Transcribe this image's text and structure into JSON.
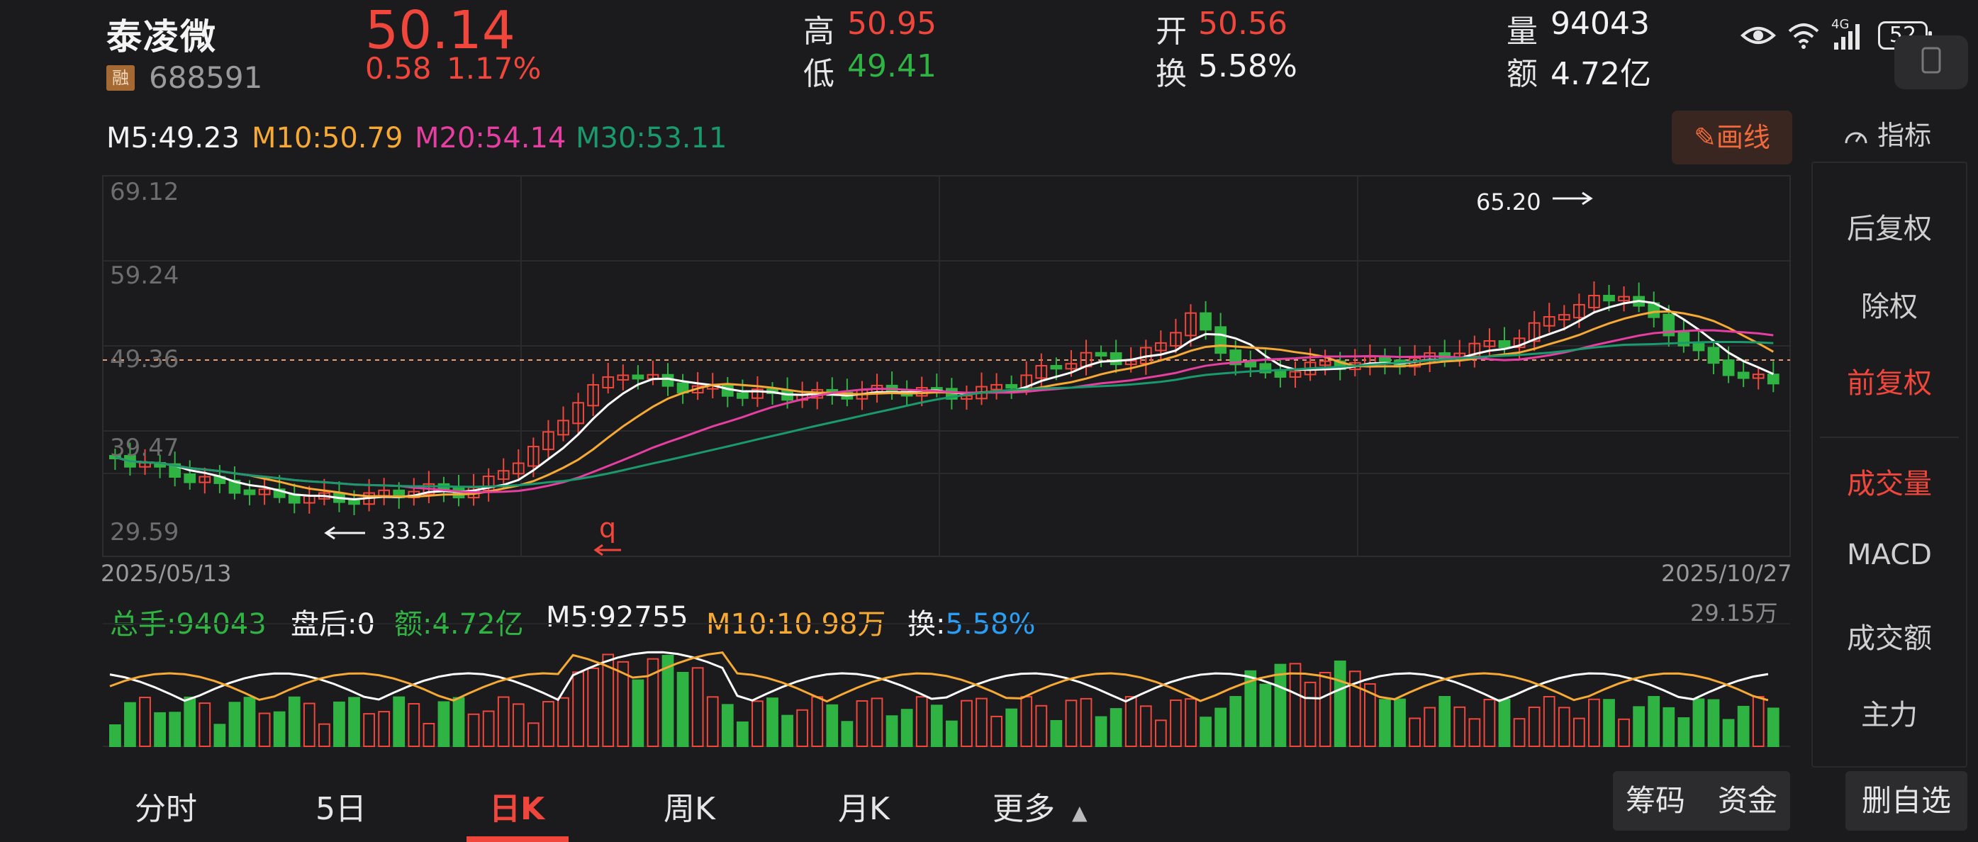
{
  "header": {
    "name": "泰凌微",
    "margin_badge": "融",
    "code": "688591",
    "price": "50.14",
    "change": "0.58",
    "change_pct": "1.17%",
    "high_label": "高",
    "high": "50.95",
    "low_label": "低",
    "low": "49.41",
    "open_label": "开",
    "open": "50.56",
    "turnover_label": "换",
    "turnover": "5.58%",
    "volume_label": "量",
    "volume": "94043",
    "amount_label": "额",
    "amount": "4.72亿"
  },
  "status_bar": {
    "network": "4G",
    "battery": "52"
  },
  "ma_legend": {
    "m5": "M5:49.23",
    "m10": "M10:50.79",
    "m20": "M20:54.14",
    "m30": "M30:53.11"
  },
  "colors": {
    "up": "#f0463c",
    "down": "#2fb343",
    "ma5": "#ffffff",
    "ma10": "#f7a935",
    "ma20": "#e63fa2",
    "ma30": "#1a9a6c",
    "turnover_blue": "#2a9df4"
  },
  "toolbar": {
    "draw_label": "画线",
    "indicator_label": "指标"
  },
  "kline": {
    "y_ticks": [
      "69.12",
      "59.24",
      "49.36",
      "39.47",
      "29.59"
    ],
    "start_date": "2025/05/13",
    "end_date": "2025/10/27",
    "high_mark": "65.20",
    "low_mark": "33.52",
    "event_marker": "q"
  },
  "volume_legend": {
    "total_label": "总手:94043",
    "after_hours": "盘后:0",
    "amount": "额:4.72亿",
    "m5": "M5:92755",
    "m10": "M10:10.98万",
    "turnover_label": "换:",
    "turnover_value": "5.58%",
    "max_label": "29.15万"
  },
  "side_panel": {
    "items": [
      "后复权",
      "除权",
      "前复权",
      "成交量",
      "MACD",
      "成交额",
      "主力"
    ]
  },
  "tabs": [
    "分时",
    "5日",
    "日K",
    "周K",
    "月K",
    "更多"
  ],
  "bottom_buttons": {
    "chips": "筹码",
    "funds": "资金",
    "remove": "删自选"
  }
}
